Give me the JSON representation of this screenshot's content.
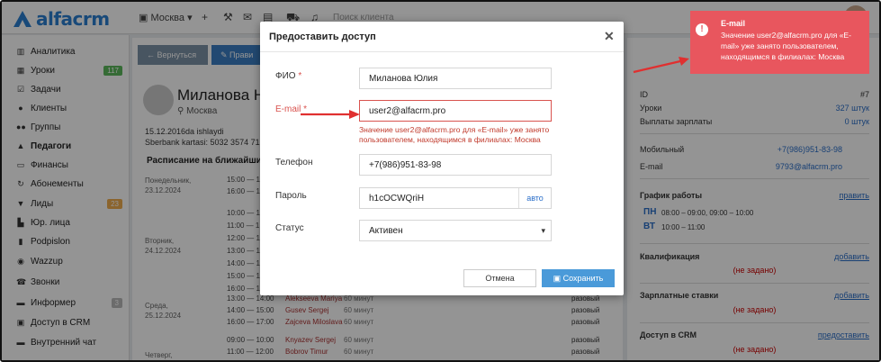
{
  "app": {
    "logo_text": "alfacrm"
  },
  "topbar": {
    "city": "Москва",
    "search_placeholder": "Поиск клиента"
  },
  "sidebar": {
    "items": [
      {
        "label": "Аналитика",
        "icon": "chart-icon"
      },
      {
        "label": "Уроки",
        "badge": "117",
        "badge_color": "#5cb85c",
        "icon": "calendar-icon"
      },
      {
        "label": "Задачи",
        "icon": "tasks-icon"
      },
      {
        "label": "Клиенты",
        "icon": "user-icon"
      },
      {
        "label": "Группы",
        "icon": "users-icon"
      },
      {
        "label": "Педагоги",
        "icon": "graduation-icon",
        "active": true
      },
      {
        "label": "Финансы",
        "icon": "money-icon"
      },
      {
        "label": "Абонементы",
        "icon": "refresh-icon"
      },
      {
        "label": "Лиды",
        "badge": "23",
        "badge_color": "#f0ad4e",
        "icon": "funnel-icon"
      },
      {
        "label": "Юр. лица",
        "icon": "building-icon"
      },
      {
        "label": "Podpislon",
        "icon": "doc-icon"
      },
      {
        "label": "Wazzup",
        "icon": "whatsapp-icon"
      },
      {
        "label": "Звонки",
        "icon": "phone-icon"
      },
      {
        "label": "Информер",
        "badge": "3",
        "badge_color": "#bbbbbb",
        "icon": "info-icon"
      },
      {
        "label": "Доступ в CRM",
        "icon": "lock-icon"
      },
      {
        "label": "Внутренний чат",
        "icon": "chat-icon"
      }
    ]
  },
  "main": {
    "back_button": "← Вернуться",
    "edit_button": "✎ Прави",
    "person_name": "Миланова Н",
    "person_city": "Москва",
    "note_line1": "15.12.2016da ishlaydi",
    "note_line2": "Sberbank kartasi: 5032 3574 71",
    "schedule_title": "Расписание на ближайши",
    "days": [
      {
        "weekday": "Понедельник,",
        "date": "23.12.2024"
      },
      {
        "weekday": "Вторник,",
        "date": "24.12.2024"
      },
      {
        "weekday": "Среда,",
        "date": "25.12.2024"
      },
      {
        "weekday": "Четверг,",
        "date": ""
      }
    ],
    "slots_mon": [
      "15:00 — 1",
      "16:00 — 17"
    ],
    "slots_tue": [
      "10:00 — 1",
      "11:00 — 1",
      "12:00 — 1",
      "13:00 — 1",
      "14:00 — 1",
      "15:00 — 1",
      "16:00 — 1"
    ],
    "lessons": [
      {
        "time": "13:00 — 14:00",
        "name": "Alekseeva Mariya",
        "dur": "60 минут",
        "kind": "разовый"
      },
      {
        "time": "14:00 — 15:00",
        "name": "Gusev Sergej",
        "dur": "60 минут",
        "kind": "разовый"
      },
      {
        "time": "16:00 — 17:00",
        "name": "Zajceva Miloslava",
        "dur": "60 минут",
        "kind": "разовый"
      },
      {
        "time": "09:00 — 10:00",
        "name": "Knyazev Sergej",
        "dur": "60 минут",
        "kind": "разовый"
      },
      {
        "time": "11:00 — 12:00",
        "name": "Bobrov Timur",
        "dur": "60 минут",
        "kind": "разовый"
      }
    ]
  },
  "right": {
    "id_label": "ID",
    "id_value": "#7",
    "lessons_label": "Уроки",
    "lessons_value": "327 штук",
    "payouts_label": "Выплаты зарплаты",
    "payouts_value": "0 штук",
    "mobile_label": "Мобильный",
    "mobile_value": "+7(986)951-83-98",
    "email_label": "E-mail",
    "email_value": "9793@alfacrm.pro",
    "schedule_label": "График работы",
    "schedule_link": "править",
    "mon_label": "ПН",
    "mon_time": "08:00 – 09:00, 09:00 – 10:00",
    "tue_label": "ВТ",
    "tue_time": "10:00 – 11:00",
    "qual_label": "Квалификация",
    "qual_link": "добавить",
    "qual_none": "(не задано)",
    "salary_label": "Зарплатные ставки",
    "salary_link": "добавить",
    "salary_none": "(не задано)",
    "access_label": "Доступ в CRM",
    "access_link": "предоставить",
    "access_none": "(не задано)"
  },
  "modal": {
    "title": "Предоставить доступ",
    "fio_label": "ФИО",
    "fio_value": "Миланова Юлия",
    "email_label": "E-mail",
    "email_value": "user2@alfacrm.pro",
    "email_error": "Значение user2@alfacrm.pro для «E-mail» уже занято пользователем, находящимся в филиалах: Москва",
    "phone_label": "Телефон",
    "phone_value": "+7(986)951-83-98",
    "password_label": "Пароль",
    "password_value": "h1cOCWQriH",
    "auto_label": "авто",
    "status_label": "Статус",
    "status_value": "Активен",
    "required_mark": "*",
    "cancel": "Отмена",
    "save": "Сохранить"
  },
  "toast": {
    "title": "E-mail",
    "message": "Значение user2@alfacrm.pro для «E-mail» уже занято пользователем, находящимся в филиалах: Москва",
    "color": "#e8565e"
  }
}
